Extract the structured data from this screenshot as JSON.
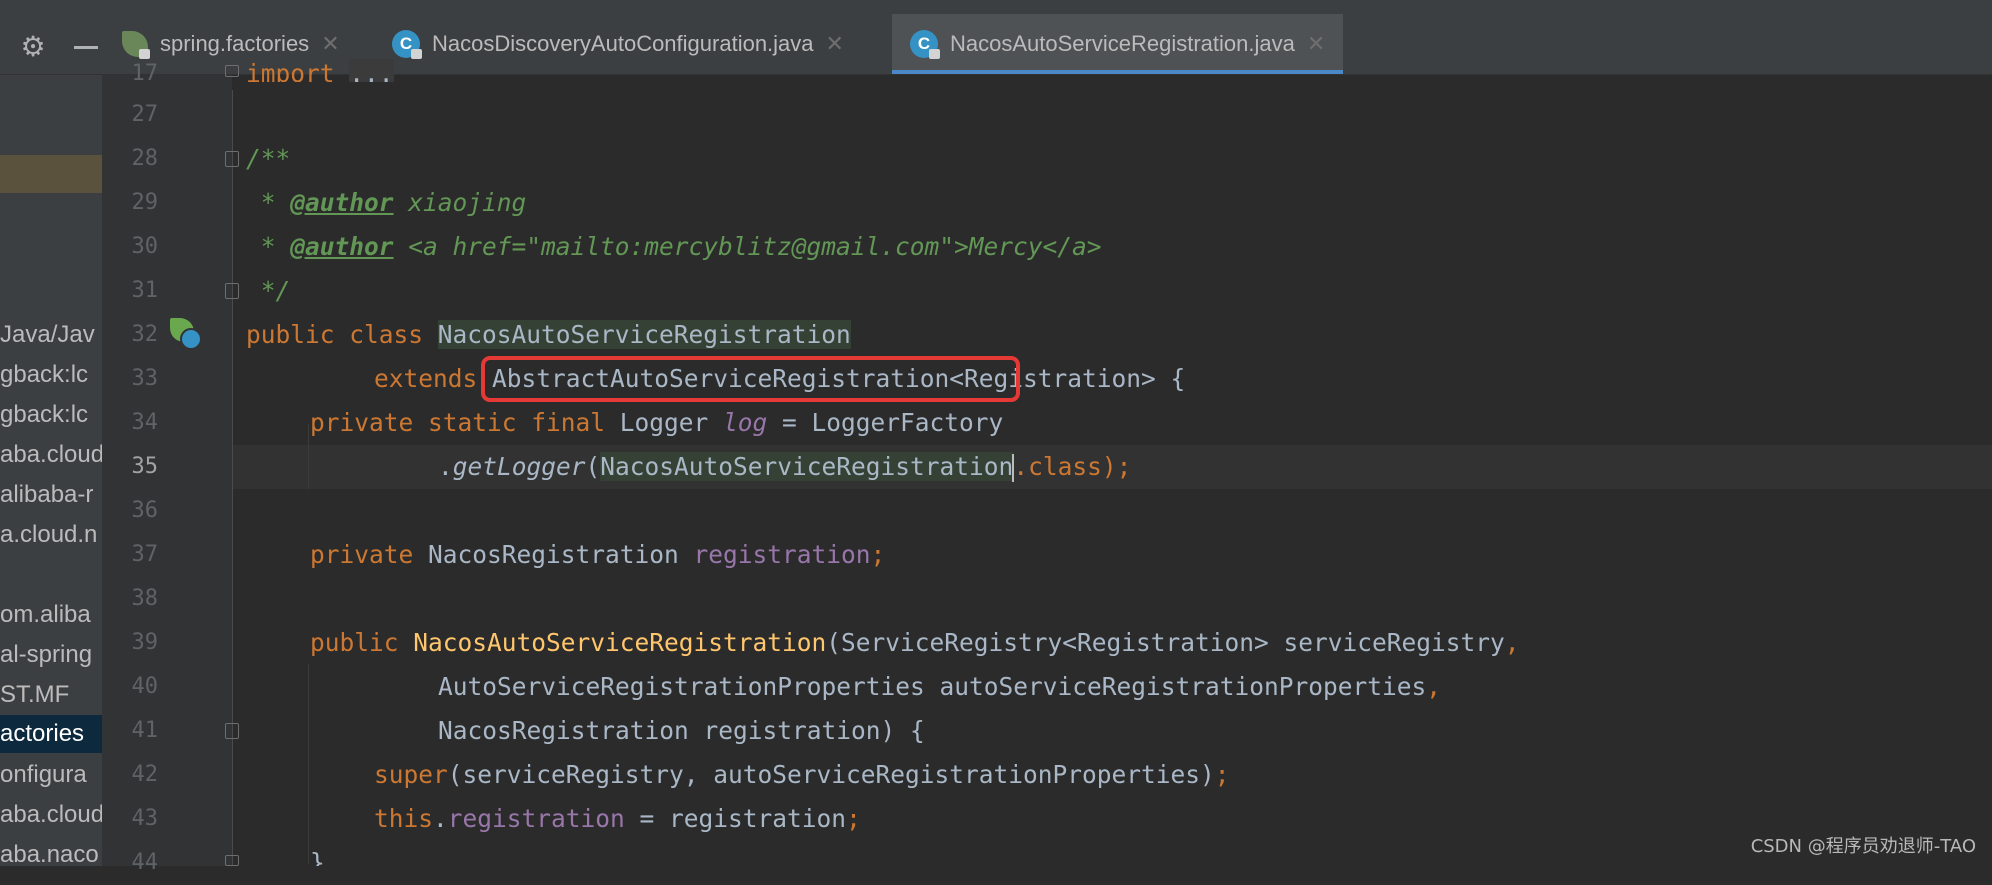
{
  "tabs": [
    {
      "label": "spring.factories",
      "icon": "spring-file-icon",
      "active": false
    },
    {
      "label": "NacosDiscoveryAutoConfiguration.java",
      "icon": "java-class-icon",
      "active": false
    },
    {
      "label": "NacosAutoServiceRegistration.java",
      "icon": "java-class-icon",
      "active": true
    }
  ],
  "tab_close_glyph": "✕",
  "sidebar": {
    "items": [
      "Java/Jav",
      "gback:lc",
      "gback:lc",
      "aba.cloud",
      "alibaba-r",
      "a.cloud.n",
      "om.aliba",
      "al-spring",
      "ST.MF",
      "actories",
      "onfigura",
      "aba.cloud",
      "aba.naco"
    ]
  },
  "editor": {
    "line_numbers": [
      "17",
      "27",
      "28",
      "29",
      "30",
      "31",
      "32",
      "33",
      "34",
      "35",
      "36",
      "37",
      "38",
      "39",
      "40",
      "41",
      "42",
      "43",
      "44"
    ],
    "current_line": "35",
    "lines": [
      {
        "import_kw": "import",
        "import_dots": "..."
      },
      {},
      {
        "text": "/**"
      },
      {
        "prefix": " * ",
        "tag": "@author",
        "rest": " xiaojing"
      },
      {
        "prefix": " * ",
        "tag": "@author",
        "rest": " <a href=\"mailto:mercyblitz@gmail.com\">Mercy</a>"
      },
      {
        "text": " */"
      },
      {
        "kw": "public class ",
        "name": "NacosAutoServiceRegistration"
      },
      {
        "kw": "extends ",
        "type": "AbstractAutoServiceRegistration<Registration>",
        "end": " {"
      },
      {
        "kw": "private static final ",
        "type": "Logger ",
        "field": "log",
        "rest": " = LoggerFactory"
      },
      {
        "dot": ".",
        "method": "getLogger",
        "open": "(",
        "arg": "NacosAutoServiceRegistration",
        "kw": ".class",
        "end": ");"
      },
      {},
      {
        "kw": "private ",
        "type": "NacosRegistration ",
        "field": "registration",
        "semi": ";"
      },
      {},
      {
        "kw": "public ",
        "method": "NacosAutoServiceRegistration",
        "rest": "(ServiceRegistry<Registration> serviceRegistry",
        "comma": ","
      },
      {
        "text": "AutoServiceRegistrationProperties autoServiceRegistrationProperties",
        "comma": ","
      },
      {
        "text": "NacosRegistration registration) {"
      },
      {
        "kw": "super",
        "rest": "(serviceRegistry, autoServiceRegistrationProperties)",
        "semi": ";"
      },
      {
        "kw": "this",
        "dot": ".",
        "field": "registration",
        "rest": " = registration",
        "semi": ";"
      },
      {
        "text": "}"
      }
    ]
  },
  "watermark": "CSDN @程序员劝退师-TAO",
  "colors": {
    "keyword": "#cc7832",
    "comment": "#629755",
    "field": "#9876aa",
    "method": "#ffc66d",
    "highlight_box": "#e53935"
  }
}
